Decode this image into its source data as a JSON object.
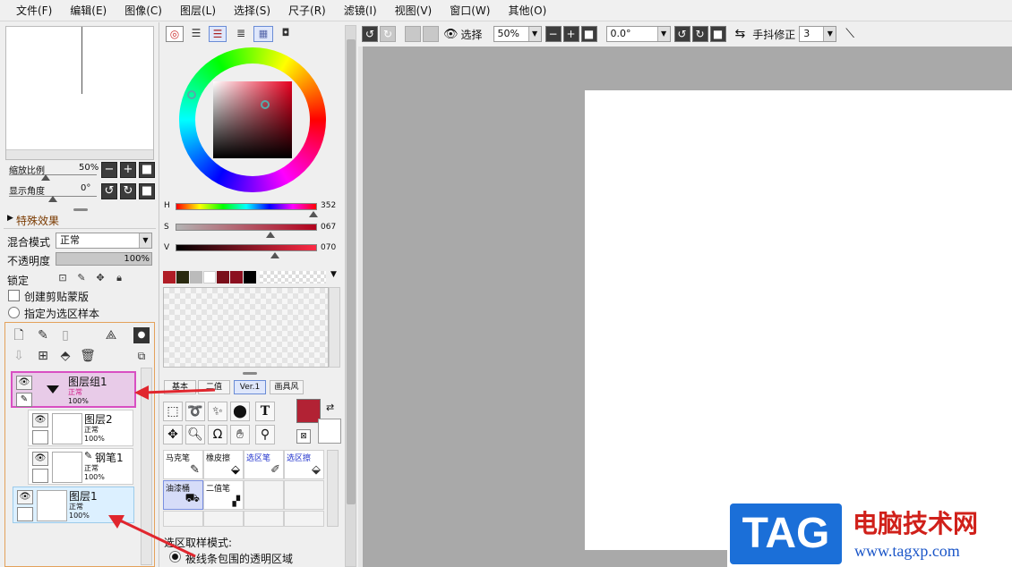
{
  "menu": [
    "文件(F)",
    "编辑(E)",
    "图像(C)",
    "图层(L)",
    "选择(S)",
    "尺子(R)",
    "滤镜(I)",
    "视图(V)",
    "窗口(W)",
    "其他(O)"
  ],
  "navigator": {
    "zoom_label": "缩放比例",
    "zoom_value": "50%",
    "angle_label": "显示角度",
    "angle_value": "0°"
  },
  "layer_props": {
    "effects_label": "特殊效果",
    "blend_label": "混合模式",
    "blend_value": "正常",
    "opacity_label": "不透明度",
    "opacity_value": "100%",
    "lock_label": "锁定",
    "clip_label": "创建剪贴蒙版",
    "sample_label": "指定为选区样本"
  },
  "layers": [
    {
      "name": "图层组1",
      "mode": "正常",
      "opacity": "100%"
    },
    {
      "name": "图层2",
      "mode": "正常",
      "opacity": "100%"
    },
    {
      "name": "钢笔1",
      "mode": "正常",
      "opacity": "100%"
    },
    {
      "name": "图层1",
      "mode": "正常",
      "opacity": "100%"
    }
  ],
  "color": {
    "h_label": "H",
    "h_value": "352",
    "s_label": "S",
    "s_value": "067",
    "v_label": "V",
    "v_value": "070",
    "h": 352,
    "s": 0.67,
    "v": 0.7,
    "main_color": "#b22234",
    "history_colors": [
      "#b01c25",
      "#2a2a10",
      "#bbbbbb",
      "#ffffff",
      "#7a0f1a",
      "#8b0f1f",
      "#000000"
    ]
  },
  "tool_tabs": [
    "基本",
    "二值",
    "Ver.1",
    "画具风"
  ],
  "brushes": [
    [
      "马克笔",
      "橡皮擦",
      "选区笔",
      "选区擦"
    ],
    [
      "油漆桶",
      "二值笔",
      "",
      ""
    ]
  ],
  "sample_mode": {
    "label": "选区取样模式:",
    "option": "被线条包围的透明区域"
  },
  "toolbar": {
    "select_label": "选择",
    "zoom_value": "50%",
    "angle_value": "0.0°",
    "stabilizer_label": "手抖修正",
    "stabilizer_value": "3"
  },
  "watermark": {
    "logo": "TAG",
    "title": "电脑技术网",
    "url": "www.tagxp.com"
  },
  "colors": {
    "accent_layer_group": "#e38fd6",
    "selected_layer": "#dcf0ff",
    "annotation_arrow": "#e0262e"
  }
}
